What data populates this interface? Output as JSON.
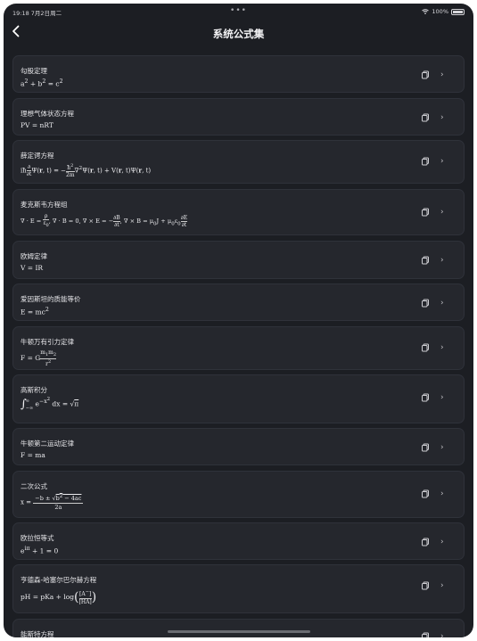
{
  "status": {
    "time_date": "19:18  7月2日周二",
    "dots": "•••",
    "wifi": "",
    "battery": "100%"
  },
  "header": {
    "title": "系统公式集",
    "back_icon": "chevron-left-icon"
  },
  "formulas": [
    {
      "name": "勾股定理",
      "formula": "a² + b² = c²"
    },
    {
      "name": "理想气体状态方程",
      "formula": "PV = nRT"
    },
    {
      "name": "薛定谔方程",
      "formula": "iħ ∂/∂t Ψ(r, t) = − ħ²/2m ∇²Ψ(r, t) + V(r, t)Ψ(r, t)"
    },
    {
      "name": "麦克斯韦方程组",
      "formula": "∇ · E = ρ/ε₀, ∇ · B = 0, ∇ × E = − ∂B/∂t, ∇ × B = μ₀J + μ₀ε₀ ∂E/∂t"
    },
    {
      "name": "欧姆定律",
      "formula": "V = IR"
    },
    {
      "name": "爱因斯坦的质能等价",
      "formula": "E = mc²"
    },
    {
      "name": "牛顿万有引力定律",
      "formula": "F = G m₁m₂/r²"
    },
    {
      "name": "高斯积分",
      "formula": "∫₋∞^∞ e^(−x²) dx = √π"
    },
    {
      "name": "牛顿第二运动定律",
      "formula": "F = ma"
    },
    {
      "name": "二次公式",
      "formula": "x = (−b ± √(b² − 4ac)) / 2a"
    },
    {
      "name": "欧拉恒等式",
      "formula": "e^(iπ) + 1 = 0"
    },
    {
      "name": "亨德森-哈塞尔巴尔赫方程",
      "formula": "pH = pKa + log([A⁻]/[HA])"
    },
    {
      "name": "能斯特方程",
      "formula": ""
    }
  ],
  "row_actions": {
    "copy_icon": "copy-icon",
    "chevron_icon": "chevron-right-icon"
  }
}
